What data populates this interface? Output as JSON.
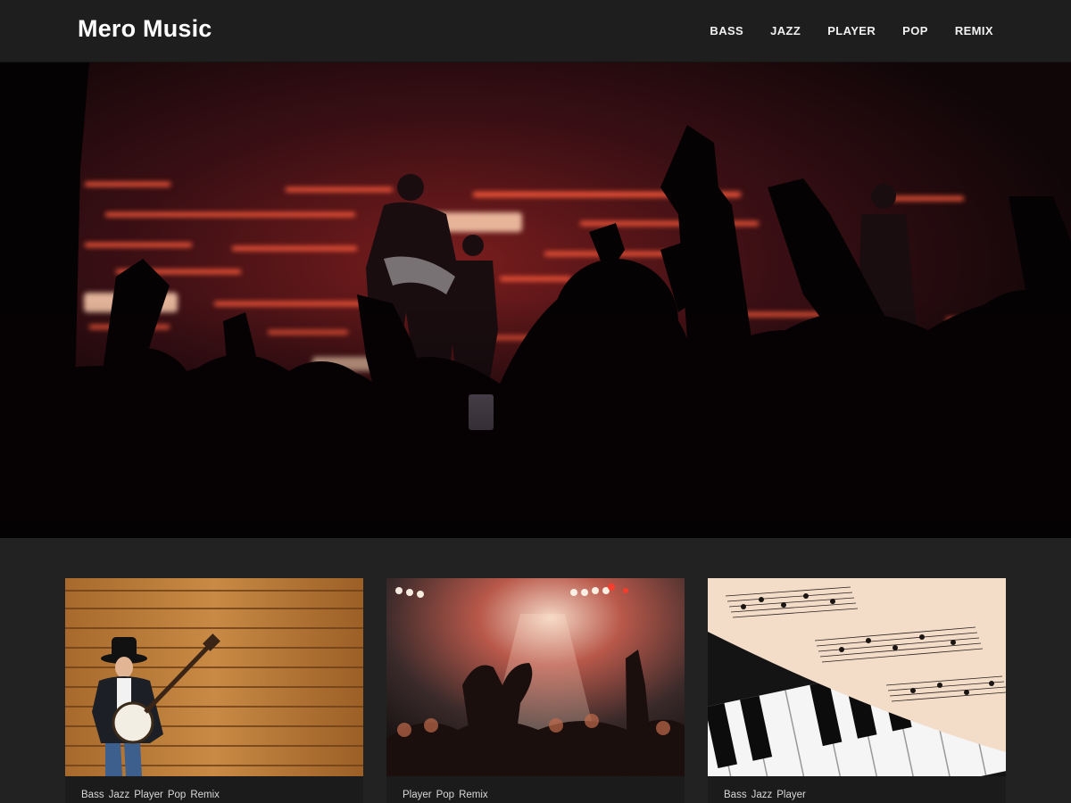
{
  "site": {
    "title": "Mero Music"
  },
  "nav": {
    "items": [
      {
        "label": "BASS"
      },
      {
        "label": "JAZZ"
      },
      {
        "label": "PLAYER"
      },
      {
        "label": "POP"
      },
      {
        "label": "REMIX"
      }
    ]
  },
  "hero": {
    "image": "concert-crowd-stage-red-lights"
  },
  "cards": [
    {
      "image": "banjo-player-wood-wall",
      "tags": [
        "Bass",
        "Jazz",
        "Player",
        "Pop",
        "Remix"
      ]
    },
    {
      "image": "concert-crowd-heart-hands",
      "tags": [
        "Player",
        "Pop",
        "Remix"
      ]
    },
    {
      "image": "sheet-music-on-piano",
      "tags": [
        "Bass",
        "Jazz",
        "Player"
      ]
    }
  ],
  "colors": {
    "header_bg": "#1e1e1e",
    "page_bg": "#222222",
    "card_bg": "#1b1b1b",
    "stage_light": "#ff4a2a"
  }
}
